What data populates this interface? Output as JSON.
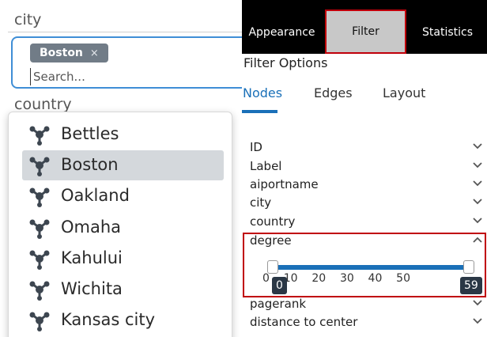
{
  "left": {
    "city_label": "city",
    "token": {
      "label": "Boston",
      "remove": "×"
    },
    "search": {
      "placeholder": "Search..."
    },
    "country_label": "country",
    "dropdown": {
      "items": [
        {
          "label": "Bettles",
          "highlighted": false
        },
        {
          "label": "Boston",
          "highlighted": true
        },
        {
          "label": "Oakland",
          "highlighted": false
        },
        {
          "label": "Omaha",
          "highlighted": false
        },
        {
          "label": "Kahului",
          "highlighted": false
        },
        {
          "label": "Wichita",
          "highlighted": false
        },
        {
          "label": "Kansas city",
          "highlighted": false
        }
      ],
      "item_icon": "graph-node-icon"
    }
  },
  "right": {
    "tabs": [
      {
        "label": "Appearance",
        "active": false
      },
      {
        "label": "Filter",
        "active": true
      },
      {
        "label": "Statistics",
        "active": false
      }
    ],
    "filter_title": "Filter Options",
    "subtabs": [
      {
        "label": "Nodes",
        "active": true
      },
      {
        "label": "Edges",
        "active": false
      },
      {
        "label": "Layout",
        "active": false
      }
    ],
    "properties": [
      {
        "label": "ID",
        "expanded": false
      },
      {
        "label": "Label",
        "expanded": false
      },
      {
        "label": "aiportname",
        "expanded": false
      },
      {
        "label": "city",
        "expanded": false
      },
      {
        "label": "country",
        "expanded": false
      },
      {
        "label": "degree",
        "expanded": true
      },
      {
        "label": "pagerank",
        "expanded": false
      },
      {
        "label": "distance to center",
        "expanded": false
      }
    ],
    "degree_slider": {
      "min": 0,
      "max": 59,
      "min_label": "0",
      "max_label": "59",
      "ticks": "0    10    20    30    40    50"
    }
  },
  "colors": {
    "accent_blue": "#1a70b8",
    "highlight_red": "#c0000a",
    "tab_bar": "#000000",
    "active_tab": "#c8c8c8",
    "token_bg": "#717c87",
    "badge_bg": "#2a3745"
  }
}
